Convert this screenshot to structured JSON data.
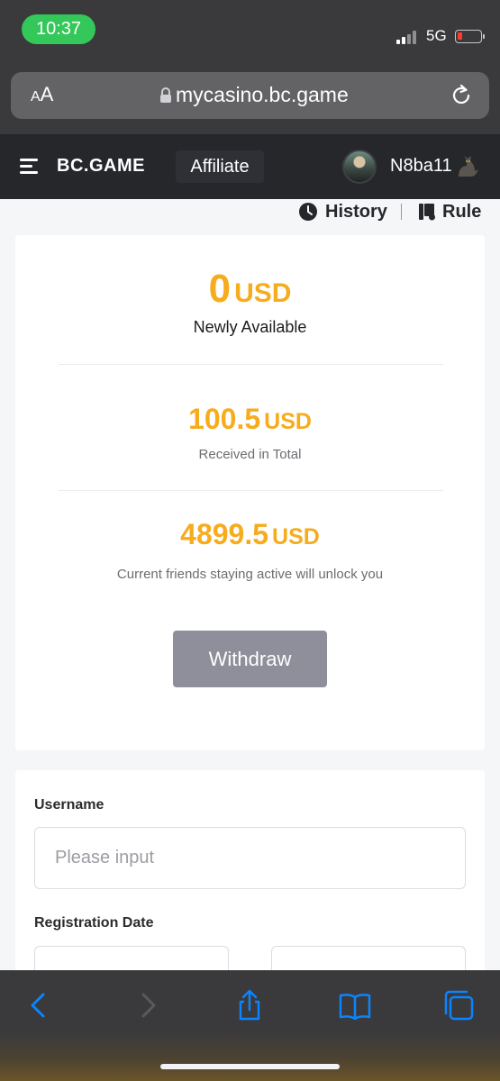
{
  "status_bar": {
    "time": "10:37",
    "network": "5G"
  },
  "browser": {
    "text_size_label_small": "A",
    "text_size_label_large": "A",
    "url": "mycasino.bc.game"
  },
  "header": {
    "brand": "BC.GAME",
    "affiliate_tab": "Affiliate",
    "username": "N8ba11"
  },
  "links": {
    "history": "History",
    "rule": "Rule"
  },
  "summary": {
    "newly_available": {
      "amount": "0",
      "currency": "USD",
      "label": "Newly Available"
    },
    "received_total": {
      "amount": "100.5",
      "currency": "USD",
      "label": "Received in Total"
    },
    "locked": {
      "amount": "4899.5",
      "currency": "USD",
      "label": "Current friends staying active will unlock you"
    },
    "withdraw_label": "Withdraw"
  },
  "filters": {
    "username_label": "Username",
    "username_placeholder": "Please input",
    "registration_date_label": "Registration Date"
  },
  "colors": {
    "accent_amount": "#f6ac1d",
    "header_bg": "#25272b",
    "withdraw_bg": "#8f8f9c",
    "time_pill": "#34c759",
    "safari_blue": "#0a84ff"
  }
}
